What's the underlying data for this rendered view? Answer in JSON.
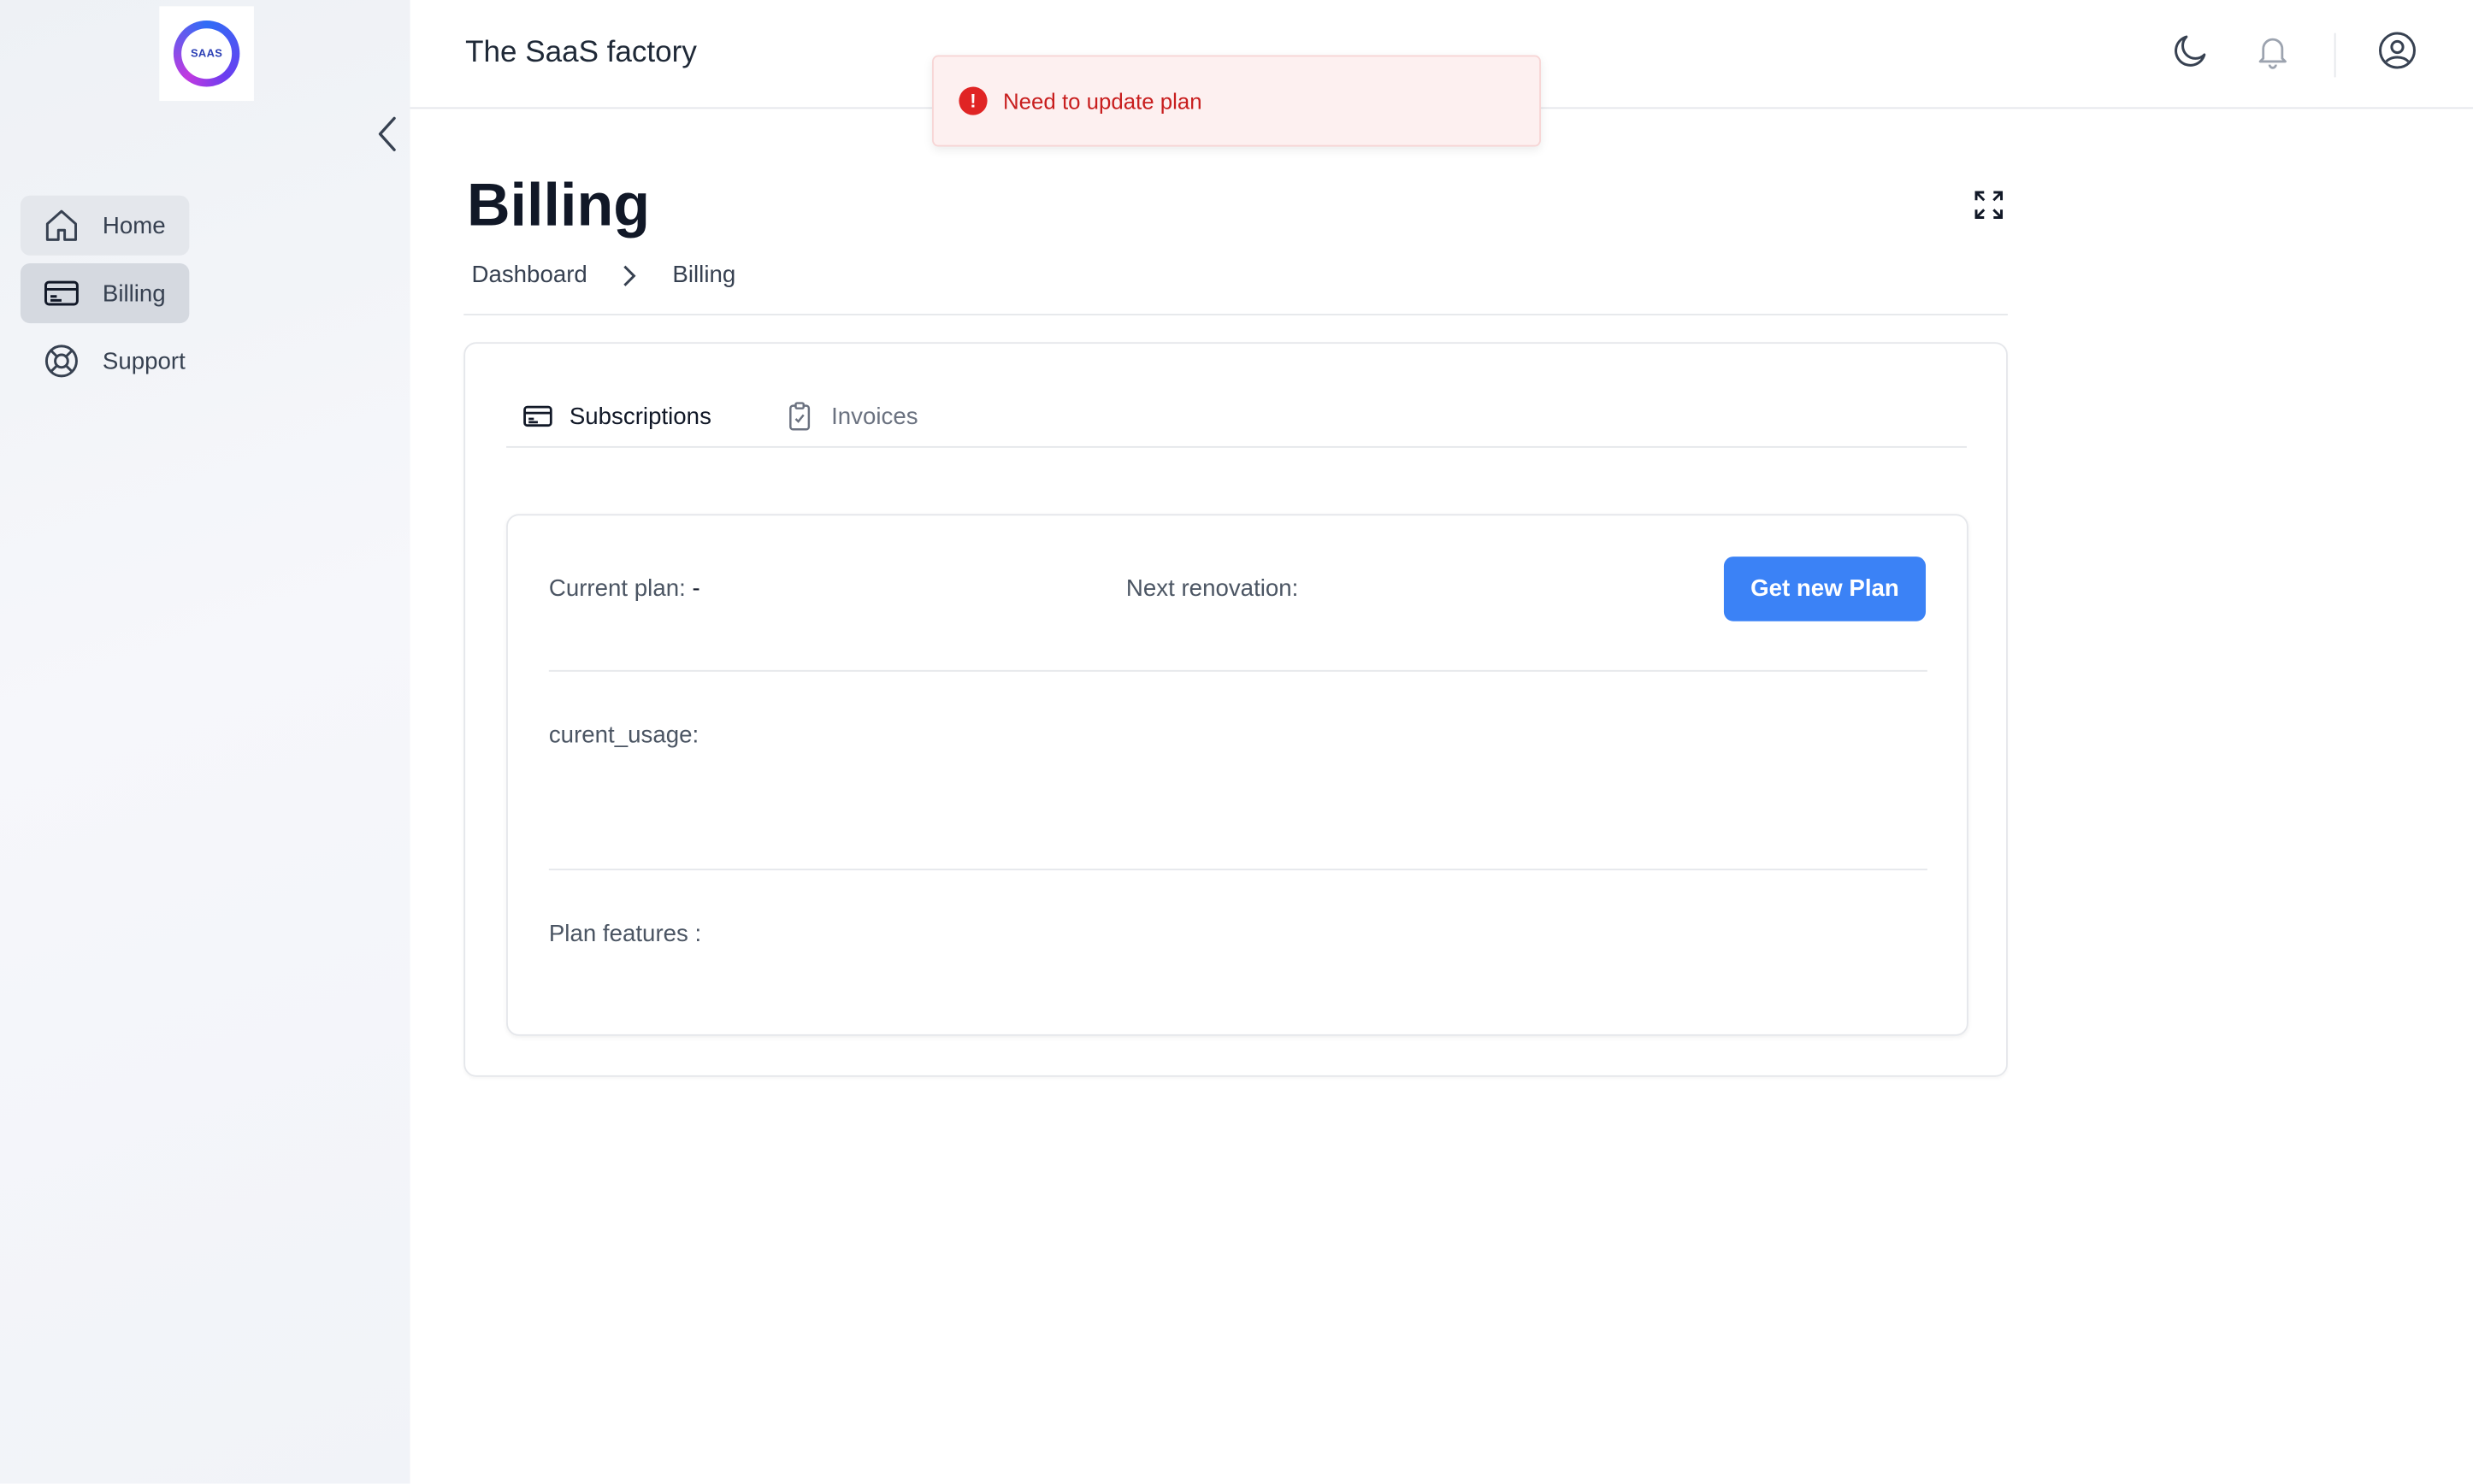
{
  "sidebar": {
    "logo_text": "SAAS",
    "items": [
      {
        "label": "Home",
        "icon": "home-icon"
      },
      {
        "label": "Billing",
        "icon": "credit-card-icon"
      },
      {
        "label": "Support",
        "icon": "lifebuoy-icon"
      }
    ]
  },
  "header": {
    "app_title": "The SaaS factory",
    "icons": [
      "moon-icon",
      "bell-icon",
      "user-circle-icon"
    ]
  },
  "toast": {
    "message": "Need to update plan",
    "icon": "!",
    "color": "#c81e1e"
  },
  "page": {
    "title": "Billing",
    "breadcrumb": [
      "Dashboard",
      "Billing"
    ]
  },
  "tabs": [
    {
      "label": "Subscriptions",
      "icon": "credit-card-icon",
      "active": true
    },
    {
      "label": "Invoices",
      "icon": "clipboard-check-icon",
      "active": false
    }
  ],
  "subscription": {
    "current_plan_label": "Current plan:",
    "current_plan_value": "-",
    "next_renovation_label": "Next renovation:",
    "get_plan_button": "Get new Plan",
    "usage_label": "curent_usage:",
    "features_label": "Plan features :"
  },
  "colors": {
    "accent": "#3b82f6",
    "error": "#e02424"
  }
}
